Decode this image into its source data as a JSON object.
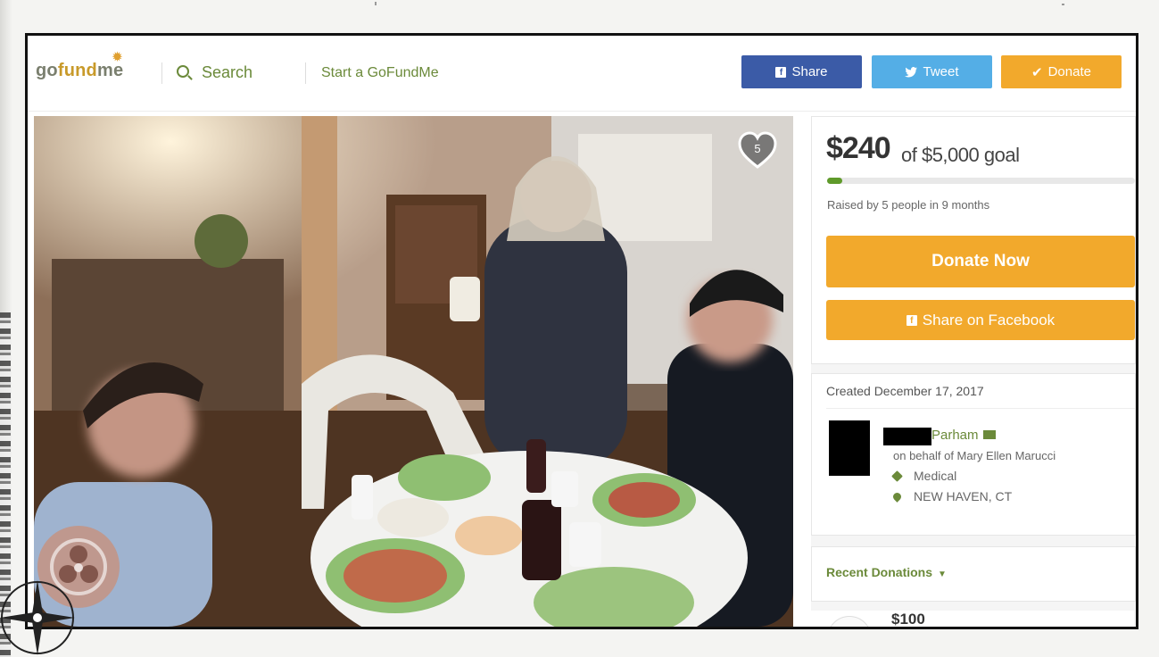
{
  "header": {
    "logo_go": "go",
    "logo_fund": "fund",
    "logo_me": "me",
    "search_label": "Search",
    "start_label": "Start a GoFundMe",
    "share_label": "Share",
    "tweet_label": "Tweet",
    "donate_label": "Donate"
  },
  "photo": {
    "heart_count": "5"
  },
  "campaign": {
    "raised_amount": "$240",
    "goal_text": "of $5,000 goal",
    "progress_percent": 4.8,
    "raised_by": "Raised by 5 people in 9 months",
    "donate_now_label": "Donate Now",
    "share_fb_label": "Share on Facebook",
    "created": "Created December 17, 2017",
    "organizer_name": "Parham",
    "on_behalf": "on behalf of Mary Ellen Marucci",
    "category": "Medical",
    "location": "NEW HAVEN, CT",
    "recent_label": "Recent Donations",
    "recent_first_amount": "$100"
  },
  "colors": {
    "brand_green": "#6b8a3a",
    "donate_orange": "#f2a92c",
    "facebook_blue": "#3b5ba7",
    "twitter_blue": "#54aee6"
  }
}
